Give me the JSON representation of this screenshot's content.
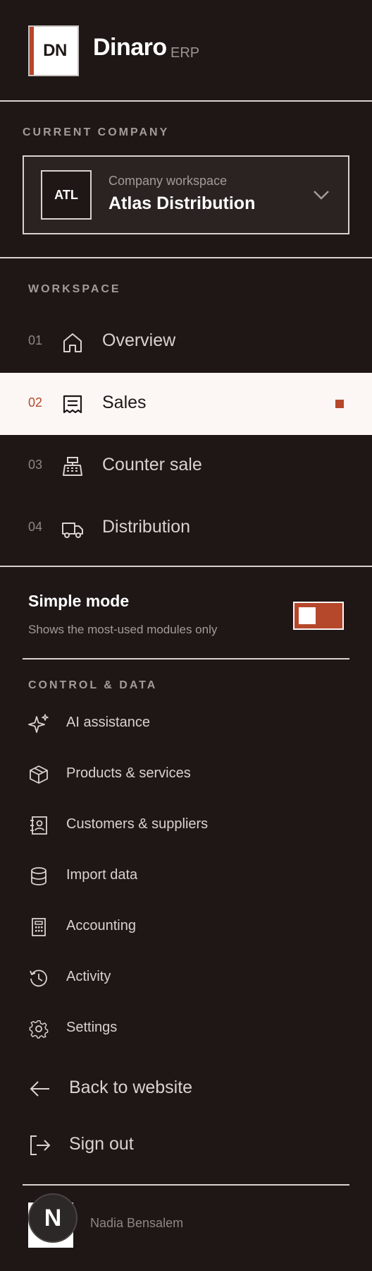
{
  "brand": {
    "logo_text": "DN",
    "name": "Dinaro",
    "suffix": "ERP"
  },
  "company": {
    "section_label": "CURRENT COMPANY",
    "badge": "ATL",
    "subtitle": "Company workspace",
    "name": "Atlas Distribution",
    "dropdown_icon": "chevron-down-icon"
  },
  "workspace": {
    "section_label": "WORKSPACE",
    "items": [
      {
        "number": "01",
        "label": "Overview",
        "icon": "home-icon",
        "active": false
      },
      {
        "number": "02",
        "label": "Sales",
        "icon": "receipt-icon",
        "active": true
      },
      {
        "number": "03",
        "label": "Counter sale",
        "icon": "cash-register-icon",
        "active": false
      },
      {
        "number": "04",
        "label": "Distribution",
        "icon": "truck-icon",
        "active": false
      }
    ]
  },
  "simple_mode": {
    "title": "Simple mode",
    "description": "Shows the most-used modules only",
    "enabled": true
  },
  "control_data": {
    "section_label": "CONTROL & DATA",
    "items": [
      {
        "label": "AI assistance",
        "icon": "sparkles-icon"
      },
      {
        "label": "Products & services",
        "icon": "package-icon"
      },
      {
        "label": "Customers & suppliers",
        "icon": "contacts-icon"
      },
      {
        "label": "Import data",
        "icon": "database-icon"
      },
      {
        "label": "Accounting",
        "icon": "calculator-icon"
      },
      {
        "label": "Activity",
        "icon": "history-icon"
      },
      {
        "label": "Settings",
        "icon": "gear-icon"
      }
    ]
  },
  "footer_links": {
    "back": {
      "label": "Back to website",
      "icon": "arrow-left-icon"
    },
    "signout": {
      "label": "Sign out",
      "icon": "sign-out-icon"
    }
  },
  "user": {
    "avatar_letter": "N",
    "name": "Nadia Bensalem"
  },
  "colors": {
    "background": "#1e1716",
    "accent": "#b5472a",
    "active_row": "#fcf7f5",
    "text": "#d9d2cf"
  }
}
